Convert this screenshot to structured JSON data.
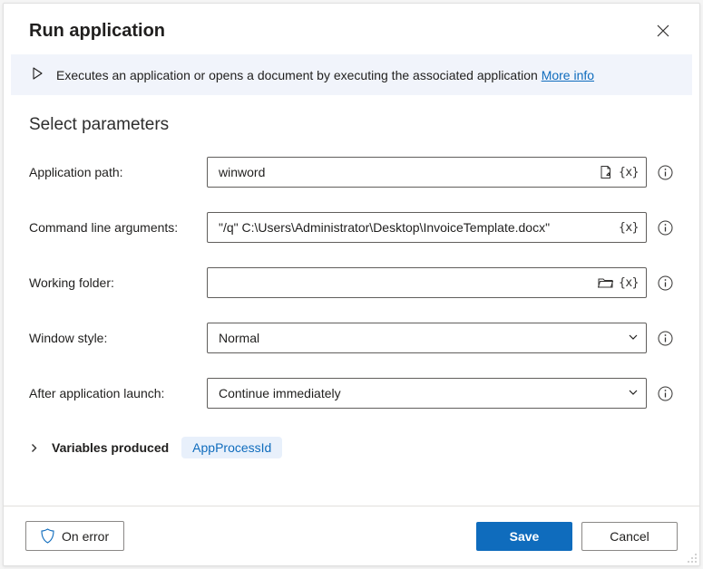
{
  "header": {
    "title": "Run application"
  },
  "banner": {
    "text": "Executes an application or opens a document by executing the associated application",
    "more_info": "More info"
  },
  "section_title": "Select parameters",
  "fields": {
    "app_path": {
      "label": "Application path:",
      "value": "winword"
    },
    "cli_args": {
      "label": "Command line arguments:",
      "value": "\"/q\" C:\\Users\\Administrator\\Desktop\\InvoiceTemplate.docx\""
    },
    "working_folder": {
      "label": "Working folder:",
      "value": ""
    },
    "window_style": {
      "label": "Window style:",
      "selected": "Normal"
    },
    "after_launch": {
      "label": "After application launch:",
      "selected": "Continue immediately"
    }
  },
  "variables_produced": {
    "label": "Variables produced",
    "items": [
      "AppProcessId"
    ]
  },
  "footer": {
    "on_error": "On error",
    "save": "Save",
    "cancel": "Cancel"
  }
}
